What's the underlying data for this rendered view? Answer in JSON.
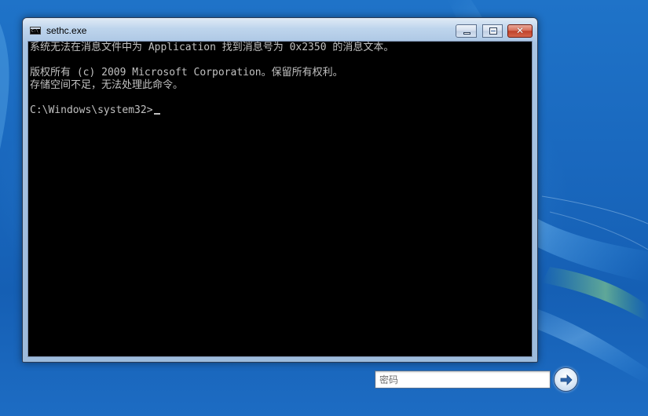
{
  "window": {
    "title": "sethc.exe",
    "icon_label": "C:\\",
    "controls": {
      "minimize": "minimize",
      "maximize": "maximize",
      "close": "✕"
    }
  },
  "console": {
    "lines": [
      "系统无法在消息文件中为 Application 找到消息号为 0x2350 的消息文本。",
      "",
      "版权所有 (c) 2009 Microsoft Corporation。保留所有权利。",
      "存储空间不足，无法处理此命令。",
      "",
      "C:\\Windows\\system32>"
    ]
  },
  "logon": {
    "password_placeholder": "密码",
    "submit_icon": "arrow-right-icon"
  },
  "colors": {
    "console_bg": "#000000",
    "console_fg": "#c0c0c0",
    "desktop_blue": "#1b63b6",
    "close_red": "#c0422a"
  }
}
